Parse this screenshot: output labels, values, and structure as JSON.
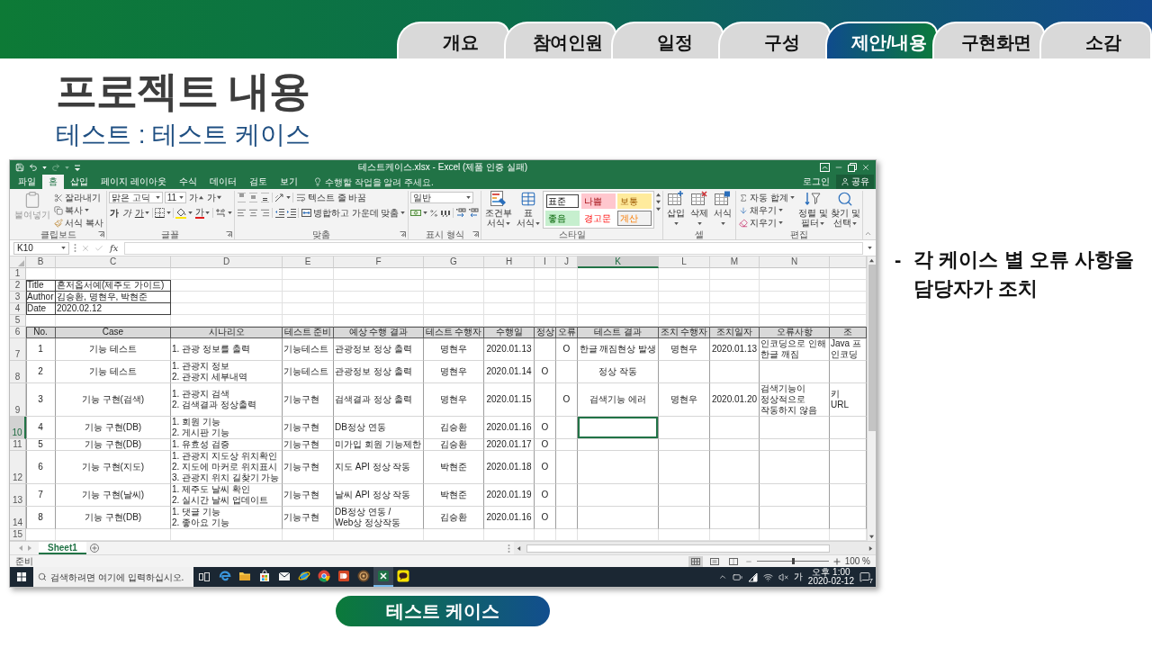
{
  "header": {
    "tabs": [
      {
        "label": "개요",
        "selected": false
      },
      {
        "label": "참여인원",
        "selected": false
      },
      {
        "label": "일정",
        "selected": false
      },
      {
        "label": "구성",
        "selected": false
      },
      {
        "label": "제안/내용",
        "selected": true
      },
      {
        "label": "구현화면",
        "selected": false
      },
      {
        "label": "소감",
        "selected": false
      }
    ]
  },
  "title": "프로젝트 내용",
  "subtitle": "테스트 : 테스트 케이스",
  "excel": {
    "window_title": "테스트케이스.xlsx - Excel (제품 인증 실패)",
    "quick_access": {
      "redo_disabled": true
    },
    "menu_tabs": [
      {
        "label": "파일",
        "selected": false
      },
      {
        "label": "홈",
        "selected": true
      },
      {
        "label": "삽입",
        "selected": false
      },
      {
        "label": "페이지 레이아웃",
        "selected": false
      },
      {
        "label": "수식",
        "selected": false
      },
      {
        "label": "데이터",
        "selected": false
      },
      {
        "label": "검토",
        "selected": false
      },
      {
        "label": "보기",
        "selected": false
      }
    ],
    "tell_me": {
      "placeholder": "수행할 작업을 알려 주세요."
    },
    "sign_in": "로그인",
    "share": "공유",
    "ribbon": {
      "clipboard": {
        "paste": "붙여넣기",
        "paste_disabled": true,
        "cut": "잘라내기",
        "copy": "복사",
        "format_painter": "서식 복사",
        "label": "클립보드"
      },
      "font": {
        "font_name": "맑은 고딕",
        "font_size": "11",
        "grow": "가",
        "shrink": "가",
        "bold": "가",
        "italic": "가",
        "underline": "가",
        "font_color": "가",
        "label": "글꼴"
      },
      "alignment": {
        "wrap_text": "텍스트 줄 바꿈",
        "merge": "병합하고 가운데 맞춤",
        "label": "맞춤"
      },
      "number": {
        "format": "일반",
        "label": "표시 형식"
      },
      "styles": {
        "conditional": "조건부 서식",
        "table": "표 서식",
        "cell_styles": [
          {
            "label": "표준",
            "kind": "normal",
            "selected": true
          },
          {
            "label": "나쁨",
            "kind": "bad",
            "selected": false
          },
          {
            "label": "보통",
            "kind": "neutral",
            "selected": false
          },
          {
            "label": "좋음",
            "kind": "good",
            "selected": false
          },
          {
            "label": "경고문",
            "kind": "warning",
            "selected": false
          },
          {
            "label": "계산",
            "kind": "calculation",
            "selected": false
          }
        ],
        "label": "스타일"
      },
      "cells": {
        "insert": "삽입",
        "delete": "삭제",
        "format": "서식",
        "label": "셀"
      },
      "editing": {
        "autosum": "자동 합계",
        "fill": "채우기",
        "clear": "지우기",
        "sort_filter": "정렬 및 필터",
        "find_select": "찾기 및 선택",
        "label": "편집"
      }
    },
    "formula_bar": {
      "name_box": "K10",
      "function_label": "fx"
    },
    "sheet": {
      "columns": [
        {
          "label": "B",
          "selected": false
        },
        {
          "label": "C",
          "selected": false
        },
        {
          "label": "D",
          "selected": false
        },
        {
          "label": "E",
          "selected": false
        },
        {
          "label": "F",
          "selected": false
        },
        {
          "label": "G",
          "selected": false
        },
        {
          "label": "H",
          "selected": false
        },
        {
          "label": "I",
          "selected": false
        },
        {
          "label": "J",
          "selected": false
        },
        {
          "label": "K",
          "selected": true
        },
        {
          "label": "L",
          "selected": false
        },
        {
          "label": "M",
          "selected": false
        },
        {
          "label": "N",
          "selected": false
        }
      ],
      "rows": [
        {
          "number": "1",
          "selected": false
        },
        {
          "number": "2",
          "selected": false,
          "info": {
            "label": "Title",
            "value": "혼저옵서예(제주도 가이드)"
          }
        },
        {
          "number": "3",
          "selected": false,
          "info": {
            "label": "Author",
            "value": "김승환, 명현우, 박현준"
          }
        },
        {
          "number": "4",
          "selected": false,
          "info": {
            "label": "Date",
            "value": "2020.02.12"
          }
        },
        {
          "number": "5",
          "selected": false
        },
        {
          "number": "6",
          "selected": false,
          "heading": {
            "no": "No.",
            "case": "Case",
            "scenario": "시나리오",
            "preparation": "테스트 준비",
            "expected": "예상 수행 결과",
            "tester": "테스트 수행자",
            "test_date": "수행일",
            "normal": "정상",
            "error": "오류",
            "result": "테스트 결과",
            "fixer": "조치 수행자",
            "fix_date": "조치일자",
            "issue": "오류사항",
            "column_o": "조"
          }
        },
        {
          "number": "7",
          "selected": false,
          "record": {
            "no": "1",
            "case": "기능 테스트",
            "scenario": "1. 관광 정보를 출력",
            "preparation": "기능테스트",
            "expected": "관광정보 정상 출력",
            "tester": "명현우",
            "test_date": "2020.01.13",
            "error": "O",
            "result": "한글 깨짐현상 발생",
            "fixer": "명현우",
            "fix_date": "2020.01.13",
            "issue": "인코딩으로 인해 한글 깨짐",
            "column_o": "Java 프\n인코딩"
          }
        },
        {
          "number": "8",
          "selected": false,
          "record": {
            "no": "2",
            "case": "기능 테스트",
            "scenario": "1. 관광지 정보\n2. 관광지 세부내역",
            "preparation": "기능테스트",
            "expected": "관광정보 정상 출력",
            "tester": "명현우",
            "test_date": "2020.01.14",
            "normal": "O",
            "result": "정상 작동"
          }
        },
        {
          "number": "9",
          "selected": false,
          "record": {
            "no": "3",
            "case": "기능 구현(검색)",
            "scenario": "1. 관광지 검색\n2. 검색결과 정상출력",
            "preparation": "기능구현",
            "expected": "검색결과 정상 출력",
            "tester": "명현우",
            "test_date": "2020.01.15",
            "error": "O",
            "result": "검색기능 에러",
            "fixer": "명현우",
            "fix_date": "2020.01.20",
            "issue": "검색기능이 정상적으로 작동하지 않음",
            "column_o": "키\nURL"
          }
        },
        {
          "number": "10",
          "selected": true,
          "record": {
            "no": "4",
            "case": "기능 구현(DB)",
            "scenario": "1. 회원 기능\n2. 게시판 기능",
            "preparation": "기능구현",
            "expected": "DB정상 연동",
            "tester": "김승환",
            "test_date": "2020.01.16",
            "normal": "O"
          }
        },
        {
          "number": "11",
          "selected": false,
          "record": {
            "no": "5",
            "case": "기능 구현(DB)",
            "scenario": "1. 유효성 검증",
            "preparation": "기능구현",
            "expected": "미가입 회원 기능제한",
            "tester": "김승환",
            "test_date": "2020.01.17",
            "normal": "O"
          }
        },
        {
          "number": "12",
          "selected": false,
          "record": {
            "no": "6",
            "case": "기능 구현(지도)",
            "scenario": "1. 관광지 지도상 위치확인\n2. 지도에 마커로 위치표시\n3. 관광지 위치 길찾기 가능",
            "preparation": "기능구현",
            "expected": "지도 API 정상 작동",
            "tester": "박현준",
            "test_date": "2020.01.18",
            "normal": "O"
          }
        },
        {
          "number": "13",
          "selected": false,
          "record": {
            "no": "7",
            "case": "기능 구현(날씨)",
            "scenario": "1. 제주도 날씨 확인\n2. 실시간 날씨 업데이트",
            "preparation": "기능구현",
            "expected": "날씨 API 정상 작동",
            "tester": "박현준",
            "test_date": "2020.01.19",
            "normal": "O"
          }
        },
        {
          "number": "14",
          "selected": false,
          "record": {
            "no": "8",
            "case": "기능 구현(DB)",
            "scenario": "1. 댓글 기능\n2. 좋아요 기능",
            "preparation": "기능구현",
            "expected": "DB정상 연동 /\nWeb상 정상작동",
            "tester": "김승환",
            "test_date": "2020.01.16",
            "normal": "O"
          }
        },
        {
          "number": "15",
          "selected": false
        }
      ]
    },
    "sheet_tabs": [
      {
        "label": "Sheet1",
        "selected": true
      }
    ],
    "status_bar": {
      "status": "준비",
      "views": [
        {
          "selected": true
        },
        {
          "selected": false
        },
        {
          "selected": false
        }
      ],
      "zoom": {
        "level": 0.5
      },
      "zoom_label": "100 %"
    },
    "taskbar": {
      "search": {
        "placeholder": "검색하려면 여기에 입력하십시오."
      },
      "apps": [
        {
          "kind": "browser_e",
          "selected": false
        },
        {
          "kind": "folder",
          "selected": false
        },
        {
          "kind": "store",
          "selected": false
        },
        {
          "kind": "mail",
          "selected": false
        },
        {
          "kind": "browser_ring",
          "selected": false
        },
        {
          "kind": "browser_circle",
          "selected": false
        },
        {
          "kind": "slides",
          "selected": false
        },
        {
          "kind": "badge",
          "selected": false
        },
        {
          "kind": "sheets",
          "selected": true
        },
        {
          "kind": "chat",
          "selected": false
        }
      ],
      "ime": "가",
      "time": "오후 1:00",
      "date": "2020-02-12",
      "notification_count": "7"
    }
  },
  "caption": "테스트 케이스",
  "bullets": [
    {
      "marker": "-",
      "text": "각 케이스 별 오류 사항을 담당자가 조치"
    }
  ]
}
